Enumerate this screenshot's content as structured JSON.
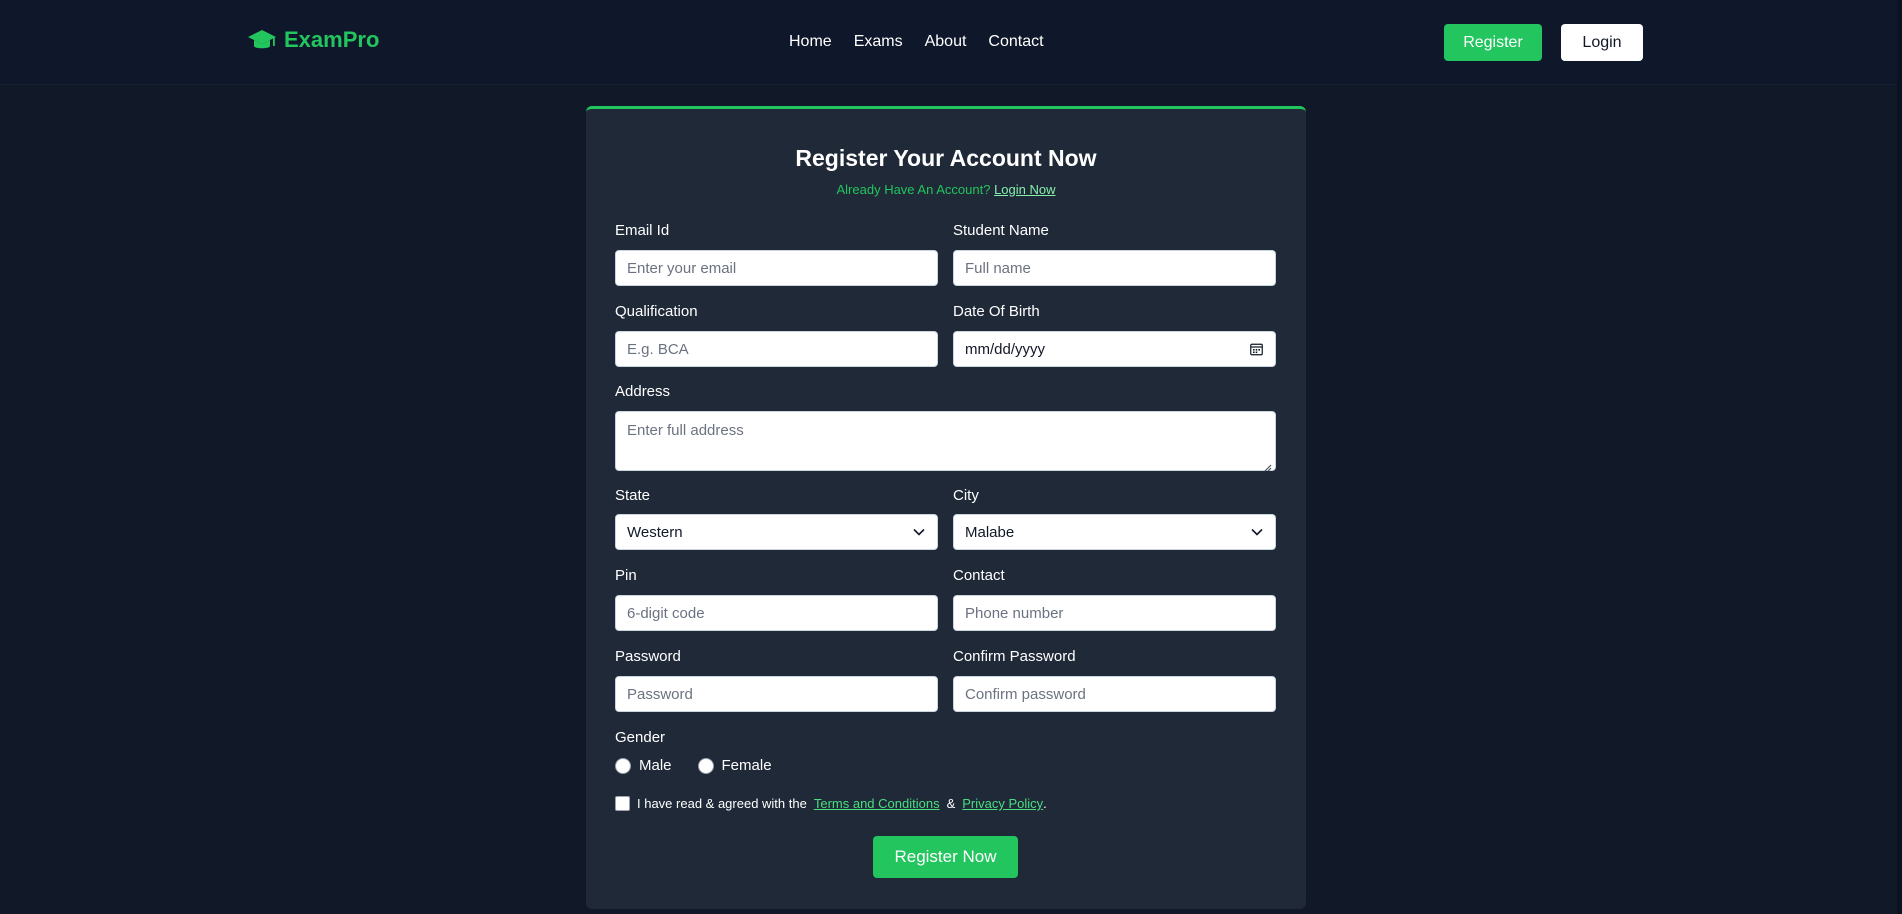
{
  "brand": {
    "name": "ExamPro",
    "icon": "graduation-cap-icon",
    "color": "#22c55e"
  },
  "nav": {
    "links": [
      "Home",
      "Exams",
      "About",
      "Contact"
    ],
    "register_label": "Register",
    "login_label": "Login"
  },
  "form": {
    "title": "Register Your Account Now",
    "subtitle_prefix": "Already Have An Account?",
    "login_link": "Login Now",
    "email": {
      "label": "Email Id",
      "placeholder": "Enter your email"
    },
    "student_name": {
      "label": "Student Name",
      "placeholder": "Full name"
    },
    "qualification": {
      "label": "Qualification",
      "placeholder": "E.g. BCA"
    },
    "dob": {
      "label": "Date Of Birth",
      "value": "mm/dd/yyyy"
    },
    "address": {
      "label": "Address",
      "placeholder": "Enter full address"
    },
    "state": {
      "label": "State",
      "value": "Western"
    },
    "city": {
      "label": "City",
      "value": "Malabe"
    },
    "pin": {
      "label": "Pin",
      "placeholder": "6-digit code"
    },
    "contact": {
      "label": "Contact",
      "placeholder": "Phone number"
    },
    "password": {
      "label": "Password",
      "placeholder": "Password"
    },
    "confirm_password": {
      "label": "Confirm Password",
      "placeholder": "Confirm password"
    },
    "gender": {
      "label": "Gender",
      "options": [
        "Male",
        "Female"
      ]
    },
    "terms": {
      "prefix": "I have read & agreed with the",
      "terms_link": "Terms and Conditions",
      "ampersand": "&",
      "privacy_link": "Privacy Policy",
      "suffix": "."
    },
    "submit_label": "Register Now"
  },
  "colors": {
    "accent": "#22c55e",
    "background": "#111827",
    "card": "#1f2937",
    "navbar": "#0f172a"
  }
}
